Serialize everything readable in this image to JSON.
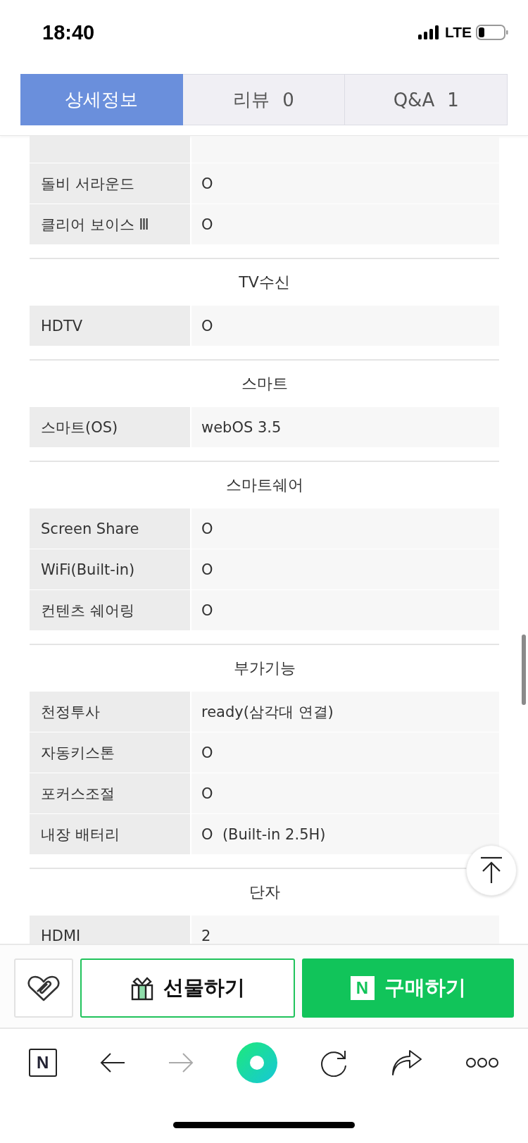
{
  "status_bar": {
    "time": "18:40",
    "network": "LTE"
  },
  "tabs": [
    {
      "label": "상세정보",
      "selected": true
    },
    {
      "label": "리뷰",
      "count": "0",
      "selected": false
    },
    {
      "label": "Q&A",
      "count": "1",
      "selected": false
    }
  ],
  "sections": [
    {
      "rows": [
        {
          "kind": "cut"
        },
        {
          "label": "돌비 서라운드",
          "value": "O"
        },
        {
          "label": "클리어 보이스 Ⅲ",
          "value": "O"
        }
      ]
    },
    {
      "title": "TV수신",
      "rows": [
        {
          "label": "HDTV",
          "value": "O"
        }
      ]
    },
    {
      "title": "스마트",
      "rows": [
        {
          "label": "스마트(OS)",
          "value": "webOS 3.5"
        }
      ]
    },
    {
      "title": "스마트쉐어",
      "rows": [
        {
          "label": "Screen Share",
          "value": "O"
        },
        {
          "label": "WiFi(Built-in)",
          "value": "O"
        },
        {
          "label": "컨텐츠 쉐어링",
          "value": "O"
        }
      ]
    },
    {
      "title": "부가기능",
      "rows": [
        {
          "label": "천정투사",
          "value": "ready(삼각대 연결)"
        },
        {
          "label": "자동키스톤",
          "value": "O"
        },
        {
          "label": "포커스조절",
          "value": "O"
        },
        {
          "label": "내장 배터리",
          "value": "O  (Built-in 2.5H)"
        }
      ]
    },
    {
      "title": "단자",
      "rows": [
        {
          "label": "HDMI",
          "value": "2"
        }
      ]
    }
  ],
  "actions": {
    "gift": "선물하기",
    "buy_logo": "N",
    "buy": "구매하기"
  },
  "browser_bar": {
    "home_logo": "N"
  }
}
